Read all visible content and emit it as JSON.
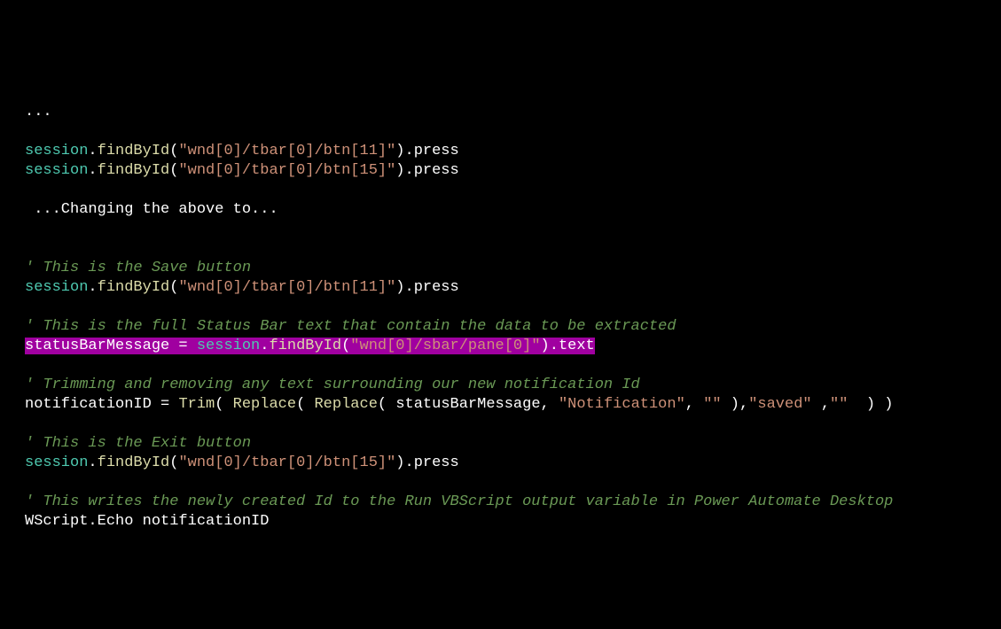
{
  "code": {
    "dots1": "...",
    "call1": {
      "obj": "session",
      "method": "findById",
      "arg": "\"wnd[0]/tbar[0]/btn[11]\"",
      "prop": ".press"
    },
    "call2": {
      "obj": "session",
      "method": "findById",
      "arg": "\"wnd[0]/tbar[0]/btn[15]\"",
      "prop": ".press"
    },
    "transition": " ...Changing the above to...",
    "c_save": "' This is the Save button",
    "call3": {
      "obj": "session",
      "method": "findById",
      "arg": "\"wnd[0]/tbar[0]/btn[11]\"",
      "prop": ".press"
    },
    "c_status": "' This is the full Status Bar text that contain the data to be extracted",
    "assign1": {
      "lhs": "statusBarMessage",
      "eq": " = ",
      "obj": "session",
      "method": "findById",
      "arg": "\"wnd[0]/sbar/pane[0]\"",
      "prop": ".text"
    },
    "c_trim": "' Trimming and removing any text surrounding our new notification Id",
    "assign2": {
      "lhs": "notificationID",
      "eq": " = ",
      "trim": "Trim",
      "lp1": "( ",
      "rep1": "Replace",
      "lp2": "( ",
      "rep2": "Replace",
      "lp3": "( ",
      "arg_var": "statusBarMessage",
      "c1": ", ",
      "s1": "\"Notification\"",
      "c2": ", ",
      "s2": "\"\"",
      "rp1": " ),",
      "s3": "\"saved\"",
      "c4": " ,",
      "s4": "\"\"",
      "tail": "  ) )"
    },
    "c_exit": "' This is the Exit button",
    "call4": {
      "obj": "session",
      "method": "findById",
      "arg": "\"wnd[0]/tbar[0]/btn[15]\"",
      "prop": ".press"
    },
    "c_write": "' This writes the newly created Id to the Run VBScript output variable in Power Automate Desktop",
    "wscript": "WScript.Echo notificationID"
  }
}
